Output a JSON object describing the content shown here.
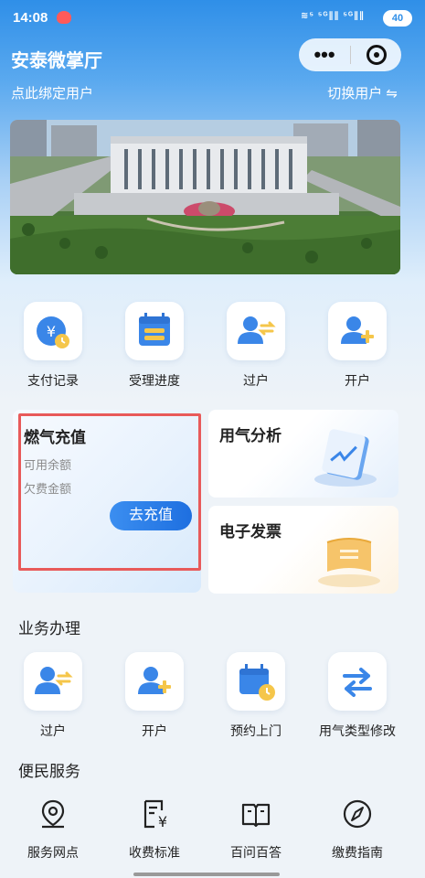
{
  "status_bar": {
    "time": "14:08",
    "signal": "≋⁵ ⁵ᴳ∥∥ ⁵ᴳ∥∥",
    "battery": "40"
  },
  "header": {
    "title": "安泰微掌厅",
    "more_glyph": "•••",
    "bind_user": "点此绑定用户",
    "switch_user": "切换用户 ⇋"
  },
  "quick_actions": [
    {
      "label": "支付记录",
      "icon": "payment-record-icon"
    },
    {
      "label": "受理进度",
      "icon": "calendar-progress-icon"
    },
    {
      "label": "过户",
      "icon": "transfer-user-icon"
    },
    {
      "label": "开户",
      "icon": "open-account-icon"
    }
  ],
  "recharge_card": {
    "title": "燃气充值",
    "balance_label": "可用余额",
    "debt_label": "欠费金额",
    "button": "去充值"
  },
  "analysis_card": {
    "title": "用气分析",
    "icon": "chart-document-icon"
  },
  "invoice_card": {
    "title": "电子发票",
    "icon": "invoice-scroll-icon"
  },
  "business": {
    "title": "业务办理",
    "items": [
      {
        "label": "过户",
        "icon": "transfer-user-icon"
      },
      {
        "label": "开户",
        "icon": "open-account-icon"
      },
      {
        "label": "预约上门",
        "icon": "appointment-calendar-icon"
      },
      {
        "label": "用气类型修改",
        "icon": "swap-arrows-icon"
      }
    ]
  },
  "services": {
    "title": "便民服务",
    "items": [
      {
        "label": "服务网点",
        "icon": "location-pin-icon"
      },
      {
        "label": "收费标准",
        "icon": "fee-standard-icon"
      },
      {
        "label": "百问百答",
        "icon": "open-book-icon"
      },
      {
        "label": "缴费指南",
        "icon": "compass-icon"
      }
    ]
  },
  "colors": {
    "primary": "#2f8fe8",
    "highlight_border": "#e85a5a",
    "icon_blue": "#3a86e8",
    "icon_yellow": "#f5c64a"
  }
}
